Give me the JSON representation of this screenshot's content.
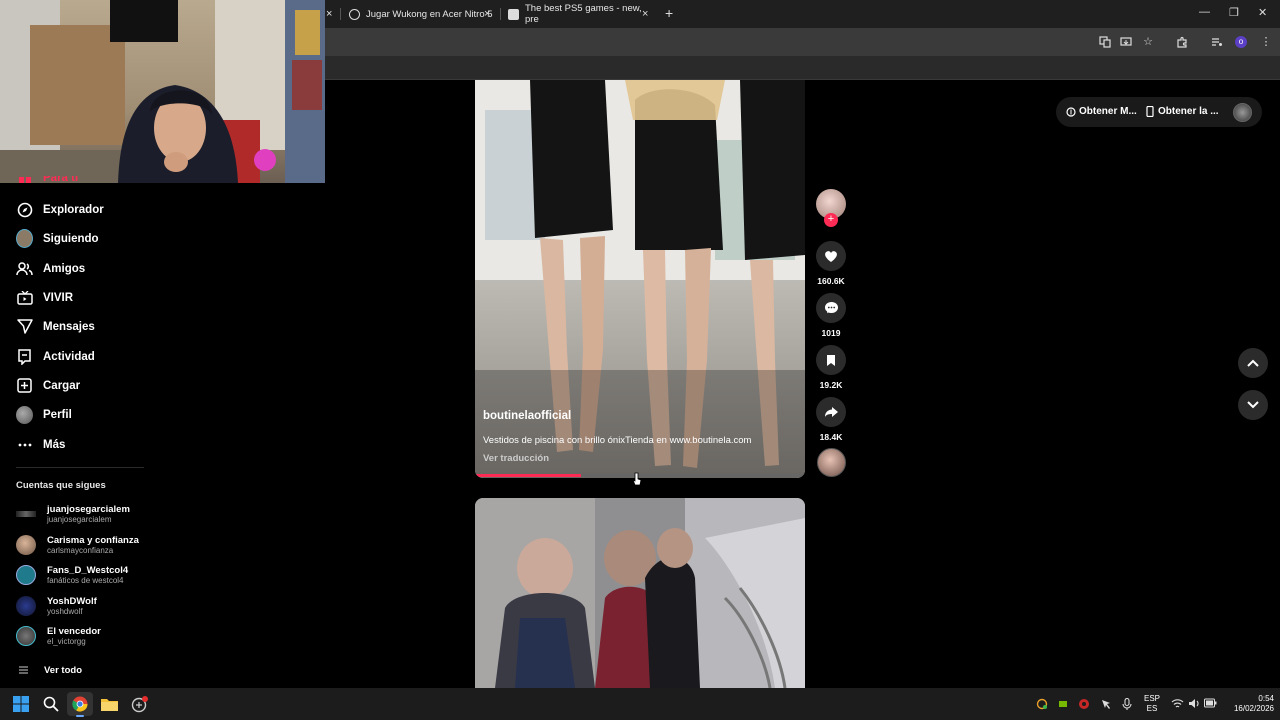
{
  "browser": {
    "tabs": [
      {
        "label": "Jugar Wukong en Acer Nitro 5"
      },
      {
        "label": "The best PS5 games - new, pre"
      }
    ],
    "profile_initial": "o"
  },
  "header": {
    "get_app_label": "Obtener M...",
    "get_mobile_label": "Obtener la ..."
  },
  "sidebar": {
    "partial_item": "Para ti",
    "items": [
      {
        "label": "Explorador",
        "icon": "compass-icon"
      },
      {
        "label": "Siguiendo",
        "icon": "avatar"
      },
      {
        "label": "Amigos",
        "icon": "friends-icon"
      },
      {
        "label": "VIVIR",
        "icon": "live-icon"
      },
      {
        "label": "Mensajes",
        "icon": "send-icon"
      },
      {
        "label": "Actividad",
        "icon": "activity-icon"
      },
      {
        "label": "Cargar",
        "icon": "upload-icon"
      },
      {
        "label": "Perfil",
        "icon": "avatar"
      },
      {
        "label": "Más",
        "icon": "more-icon"
      }
    ],
    "following_title": "Cuentas que sigues",
    "following": [
      {
        "name": "juanjosegarcialem",
        "handle": "juanjosegarcialem"
      },
      {
        "name": "Carisma y confianza",
        "handle": "carlsmayconfianza"
      },
      {
        "name": "Fans_D_Westcol4",
        "handle": "fanáticos de westcol4"
      },
      {
        "name": "YoshDWolf",
        "handle": "yoshdwolf"
      },
      {
        "name": "El vencedor",
        "handle": "el_victorgg"
      }
    ],
    "see_all": "Ver todo"
  },
  "video": {
    "author": "boutinelaofficial",
    "caption": "Vestidos de piscina con brillo ónixTienda en www.boutinela.com",
    "translate": "Ver traducción",
    "progress": 0.32
  },
  "actions": {
    "likes": "160.6K",
    "comments": "1019",
    "saves": "19.2K",
    "shares": "18.4K"
  },
  "taskbar": {
    "lang1": "ESP",
    "lang2": "ES",
    "time": "0:54",
    "date": "16/02/2026"
  }
}
